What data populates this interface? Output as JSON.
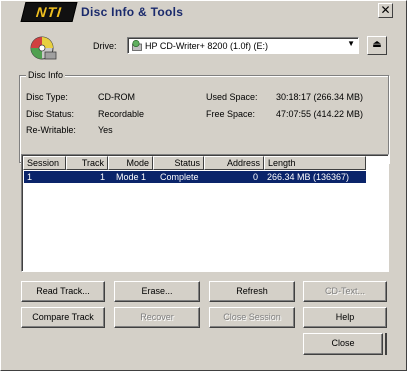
{
  "window": {
    "logo_text": "NTI",
    "title": "Disc Info & Tools",
    "close_glyph": "✕"
  },
  "drive": {
    "label": "Drive:",
    "selected": "HP CD-Writer+ 8200 (1.0f) (E:)",
    "dropdown_glyph": "▼",
    "eject_glyph": "⏏"
  },
  "disc_info": {
    "group_title": "Disc Info",
    "disc_type_label": "Disc Type:",
    "disc_type_value": "CD-ROM",
    "disc_status_label": "Disc Status:",
    "disc_status_value": "Recordable",
    "re_writable_label": "Re-Writable:",
    "re_writable_value": "Yes",
    "used_space_label": "Used Space:",
    "used_space_value": "30:18:17 (266.34 MB)",
    "free_space_label": "Free Space:",
    "free_space_value": "47:07:55 (414.22 MB)"
  },
  "table": {
    "columns": [
      "Session",
      "Track",
      "Mode",
      "Status",
      "Address",
      "Length"
    ],
    "rows": [
      {
        "session": "1",
        "track": "1",
        "mode": "Mode 1",
        "status": "Complete",
        "address": "0",
        "length": "266.34 MB (136367)"
      }
    ]
  },
  "buttons": {
    "read_track": "Read Track...",
    "erase": "Erase...",
    "refresh": "Refresh",
    "cd_text": "CD-Text...",
    "compare_track": "Compare Track",
    "recover": "Recover",
    "close_session": "Close Session",
    "help": "Help",
    "close": "Close"
  }
}
